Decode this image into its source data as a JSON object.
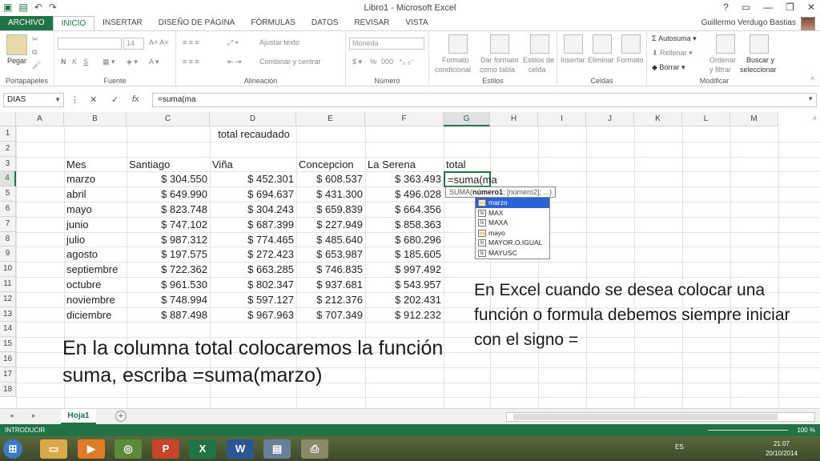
{
  "titlebar": {
    "title": "Libro1 - Microsoft Excel",
    "help": "?"
  },
  "tabs": [
    {
      "label": "ARCHIVO"
    },
    {
      "label": "INICIO"
    },
    {
      "label": "INSERTAR"
    },
    {
      "label": "DISEÑO DE PÁGINA"
    },
    {
      "label": "FÓRMULAS"
    },
    {
      "label": "DATOS"
    },
    {
      "label": "REVISAR"
    },
    {
      "label": "VISTA"
    }
  ],
  "user": {
    "name": "Guillermo Verdugo Bastias"
  },
  "ribbon": {
    "paste": "Pegar",
    "font_size": "14",
    "bold": "N",
    "italic": "K",
    "underline": "S",
    "wrap_text": "Ajustar texto",
    "merge": "Combinar y centrar",
    "number_format": "Moneda",
    "percent": "%",
    "thousands": "000",
    "cond_format_1": "Formato",
    "cond_format_2": "condicional",
    "format_table_1": "Dar formato",
    "format_table_2": "como tabla",
    "cell_styles_1": "Estilos de",
    "cell_styles_2": "celda",
    "insert": "Insertar",
    "delete": "Eliminar",
    "format": "Formato",
    "autosum": "Autosuma",
    "fill": "Rellenar",
    "clear": "Borrar",
    "sort_1": "Ordenar",
    "sort_2": "y filtrar",
    "find_1": "Buscar y",
    "find_2": "seleccionar",
    "groups": {
      "clipboard": "Portapapeles",
      "font": "Fuente",
      "alignment": "Alineación",
      "number": "Número",
      "styles": "Estilos",
      "cells": "Celdas",
      "editing": "Modificar"
    }
  },
  "formula_bar": {
    "name_box": "DIAS",
    "fx": "fx",
    "formula": "=suma(ma"
  },
  "columns": [
    "A",
    "B",
    "C",
    "D",
    "E",
    "F",
    "G",
    "H",
    "I",
    "J",
    "K",
    "L",
    "M"
  ],
  "rows": [
    "1",
    "2",
    "3",
    "4",
    "5",
    "6",
    "7",
    "8",
    "9",
    "10",
    "11",
    "12",
    "13",
    "14",
    "15",
    "16",
    "17",
    "18"
  ],
  "sheet": {
    "title": "total recaudado",
    "headers": [
      "Mes",
      "Santiago",
      "Viña",
      "Concepcion",
      "La Serena",
      "total"
    ],
    "data": [
      [
        "marzo",
        "$ 304.550",
        "$ 452.301",
        "$ 608.537",
        "$ 363.493"
      ],
      [
        "abril",
        "$ 649.990",
        "$ 694.637",
        "$ 431.300",
        "$ 496.028"
      ],
      [
        "mayo",
        "$ 823.748",
        "$ 304.243",
        "$ 659.839",
        "$ 664.356"
      ],
      [
        "junio",
        "$ 747.102",
        "$ 687.399",
        "$ 227.949",
        "$ 858.363"
      ],
      [
        "julio",
        "$ 987.312",
        "$ 774.465",
        "$ 485.640",
        "$ 680.296"
      ],
      [
        "agosto",
        "$ 197.575",
        "$ 272.423",
        "$ 653.987",
        "$ 185.605"
      ],
      [
        "septiembre",
        "$ 722.362",
        "$ 663.285",
        "$ 746.835",
        "$ 997.492"
      ],
      [
        "octubre",
        "$ 961.530",
        "$ 802.347",
        "$ 937.681",
        "$ 543.957"
      ],
      [
        "noviembre",
        "$ 748.994",
        "$ 597.127",
        "$ 212.376",
        "$ 202.431"
      ],
      [
        "diciembre",
        "$ 887.498",
        "$ 967.963",
        "$ 707.349",
        "$ 912.232"
      ]
    ],
    "active_cell_value": "=suma(ma"
  },
  "tooltip": {
    "fn": "SUMA(",
    "arg1": "número1",
    "rest": "; [número2]; ...)"
  },
  "autocomplete": [
    {
      "label": "marzo",
      "kind": "range",
      "highlighted": true
    },
    {
      "label": "MAX",
      "kind": "function"
    },
    {
      "label": "MAXA",
      "kind": "function"
    },
    {
      "label": "mayo",
      "kind": "range"
    },
    {
      "label": "MAYOR.O.IGUAL",
      "kind": "function"
    },
    {
      "label": "MAYUSC",
      "kind": "function"
    }
  ],
  "notes": {
    "left": "En la columna total colocaremos la función suma, escriba =suma(marzo)",
    "right": "En Excel cuando se desea colocar una función o formula debemos siempre iniciar con el signo ="
  },
  "sheet_tab": "Hoja1",
  "status": {
    "mode": "INTRODUCIR",
    "zoom": "100 %"
  },
  "taskbar": {
    "lang": "ES",
    "time": "21:07",
    "date": "20/10/2014"
  },
  "colors": {
    "excel_green": "#217346",
    "autocomplete_highlight": "#2b62d6"
  }
}
